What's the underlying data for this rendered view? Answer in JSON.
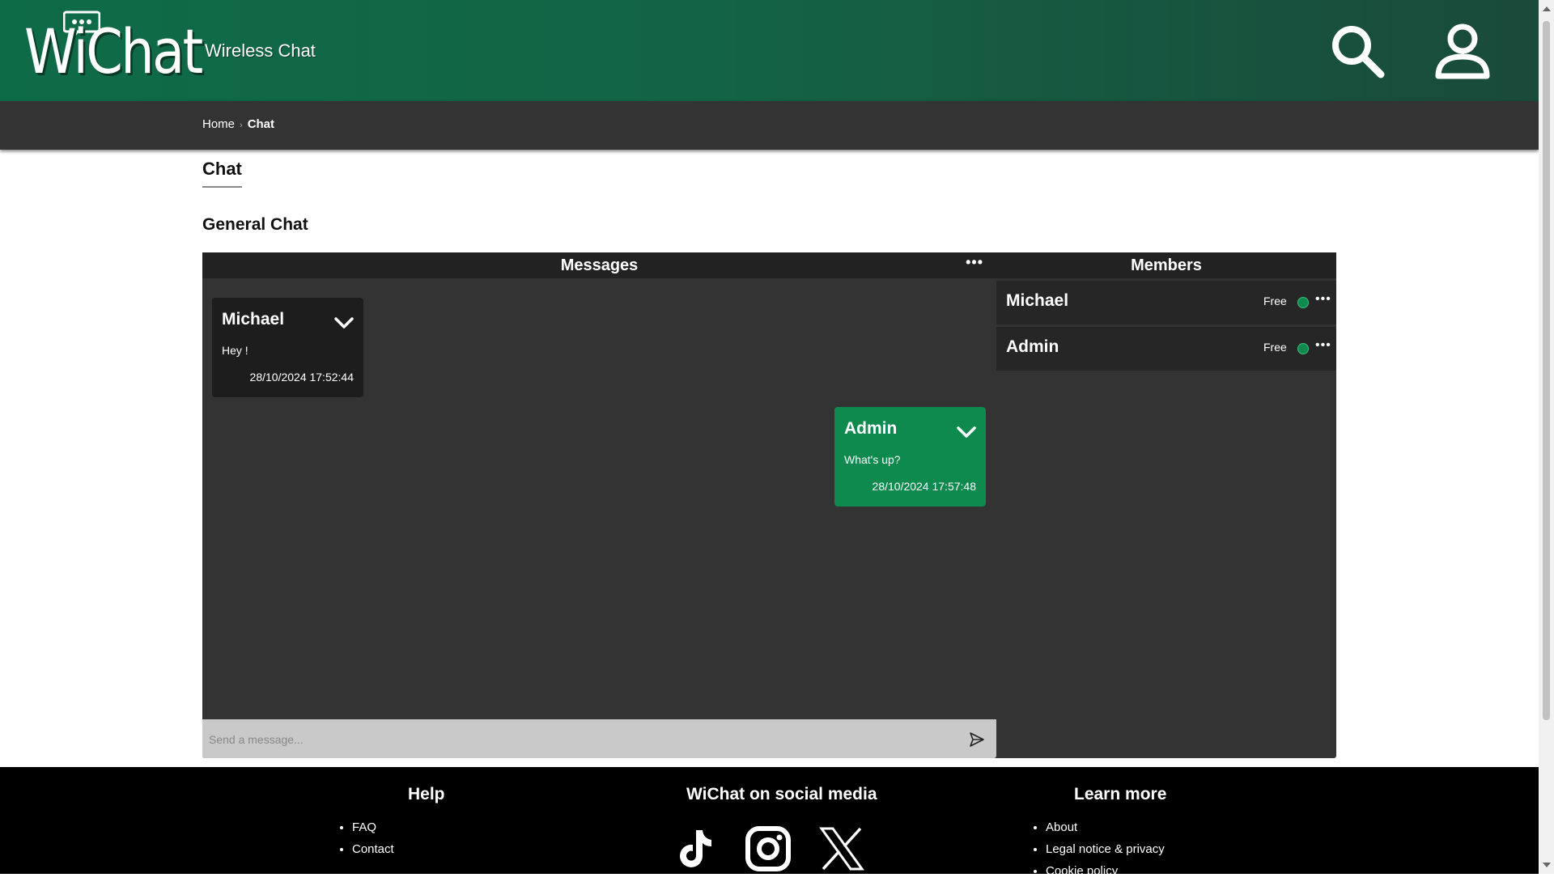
{
  "header": {
    "logo_text": "WiChat",
    "tagline": "Wireless Chat",
    "icons": [
      "search-icon",
      "user-icon"
    ]
  },
  "breadcrumb": {
    "home": "Home",
    "current": "Chat"
  },
  "page": {
    "title": "Chat",
    "section": "General Chat"
  },
  "chat": {
    "messages_header": "Messages",
    "members_header": "Members",
    "messages": [
      {
        "author": "Michael",
        "text": "Hey !",
        "time": "28/10/2024 17:52:44"
      },
      {
        "author": "Admin",
        "text": "What's up?",
        "time": "28/10/2024 17:57:48"
      }
    ],
    "members": [
      {
        "name": "Michael",
        "status": "Free"
      },
      {
        "name": "Admin",
        "status": "Free"
      }
    ],
    "composer_placeholder": "Send a message...",
    "colors": {
      "own_message": "#0e8a4f",
      "other_message": "#1d1d1d",
      "online": "#0e8a4f"
    }
  },
  "footer": {
    "help": {
      "title": "Help",
      "links": [
        "FAQ",
        "Contact"
      ]
    },
    "social": {
      "title": "WiChat on social media",
      "icons": [
        "tiktok-icon",
        "instagram-icon",
        "x-icon"
      ]
    },
    "learn": {
      "title": "Learn more",
      "links": [
        "About",
        "Legal notice & privacy",
        "Cookie policy"
      ]
    }
  }
}
